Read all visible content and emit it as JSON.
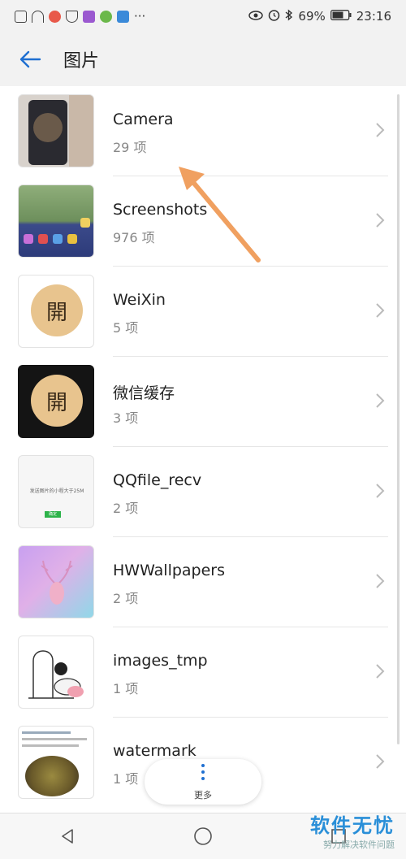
{
  "status_bar": {
    "battery": "69%",
    "time": "23:16",
    "more": "···"
  },
  "app_bar": {
    "title": "图片"
  },
  "albums": [
    {
      "name": "Camera",
      "count": "29 项"
    },
    {
      "name": "Screenshots",
      "count": "976 项"
    },
    {
      "name": "WeiXin",
      "count": "5 项"
    },
    {
      "name": "微信缓存",
      "count": "3 项"
    },
    {
      "name": "QQfile_recv",
      "count": "2 项"
    },
    {
      "name": "HWWallpapers",
      "count": "2 项"
    },
    {
      "name": "images_tmp",
      "count": "1 项"
    },
    {
      "name": "watermark",
      "count": "1 项"
    }
  ],
  "thumb_text": {
    "kai": "開",
    "qq_line": "发送图片的小程大于25M",
    "qq_btn": "确定"
  },
  "fab": {
    "label": "更多"
  },
  "watermark": {
    "title": "软件无忧",
    "subtitle": "努力解决软件问题"
  },
  "colors": {
    "accent": "#1f6fd1",
    "arrow": "#f0a060"
  }
}
